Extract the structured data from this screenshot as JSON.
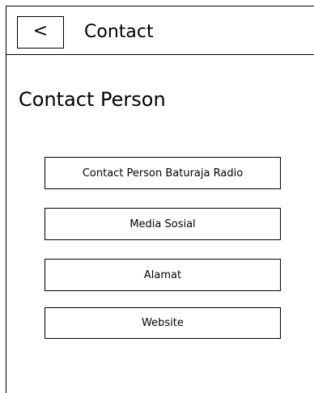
{
  "header": {
    "back_icon": "<",
    "title": "Contact"
  },
  "page": {
    "title": "Contact Person"
  },
  "menu": {
    "items": [
      {
        "label": "Contact Person Baturaja Radio"
      },
      {
        "label": "Media Sosial"
      },
      {
        "label": "Alamat"
      },
      {
        "label": "Website"
      }
    ]
  }
}
